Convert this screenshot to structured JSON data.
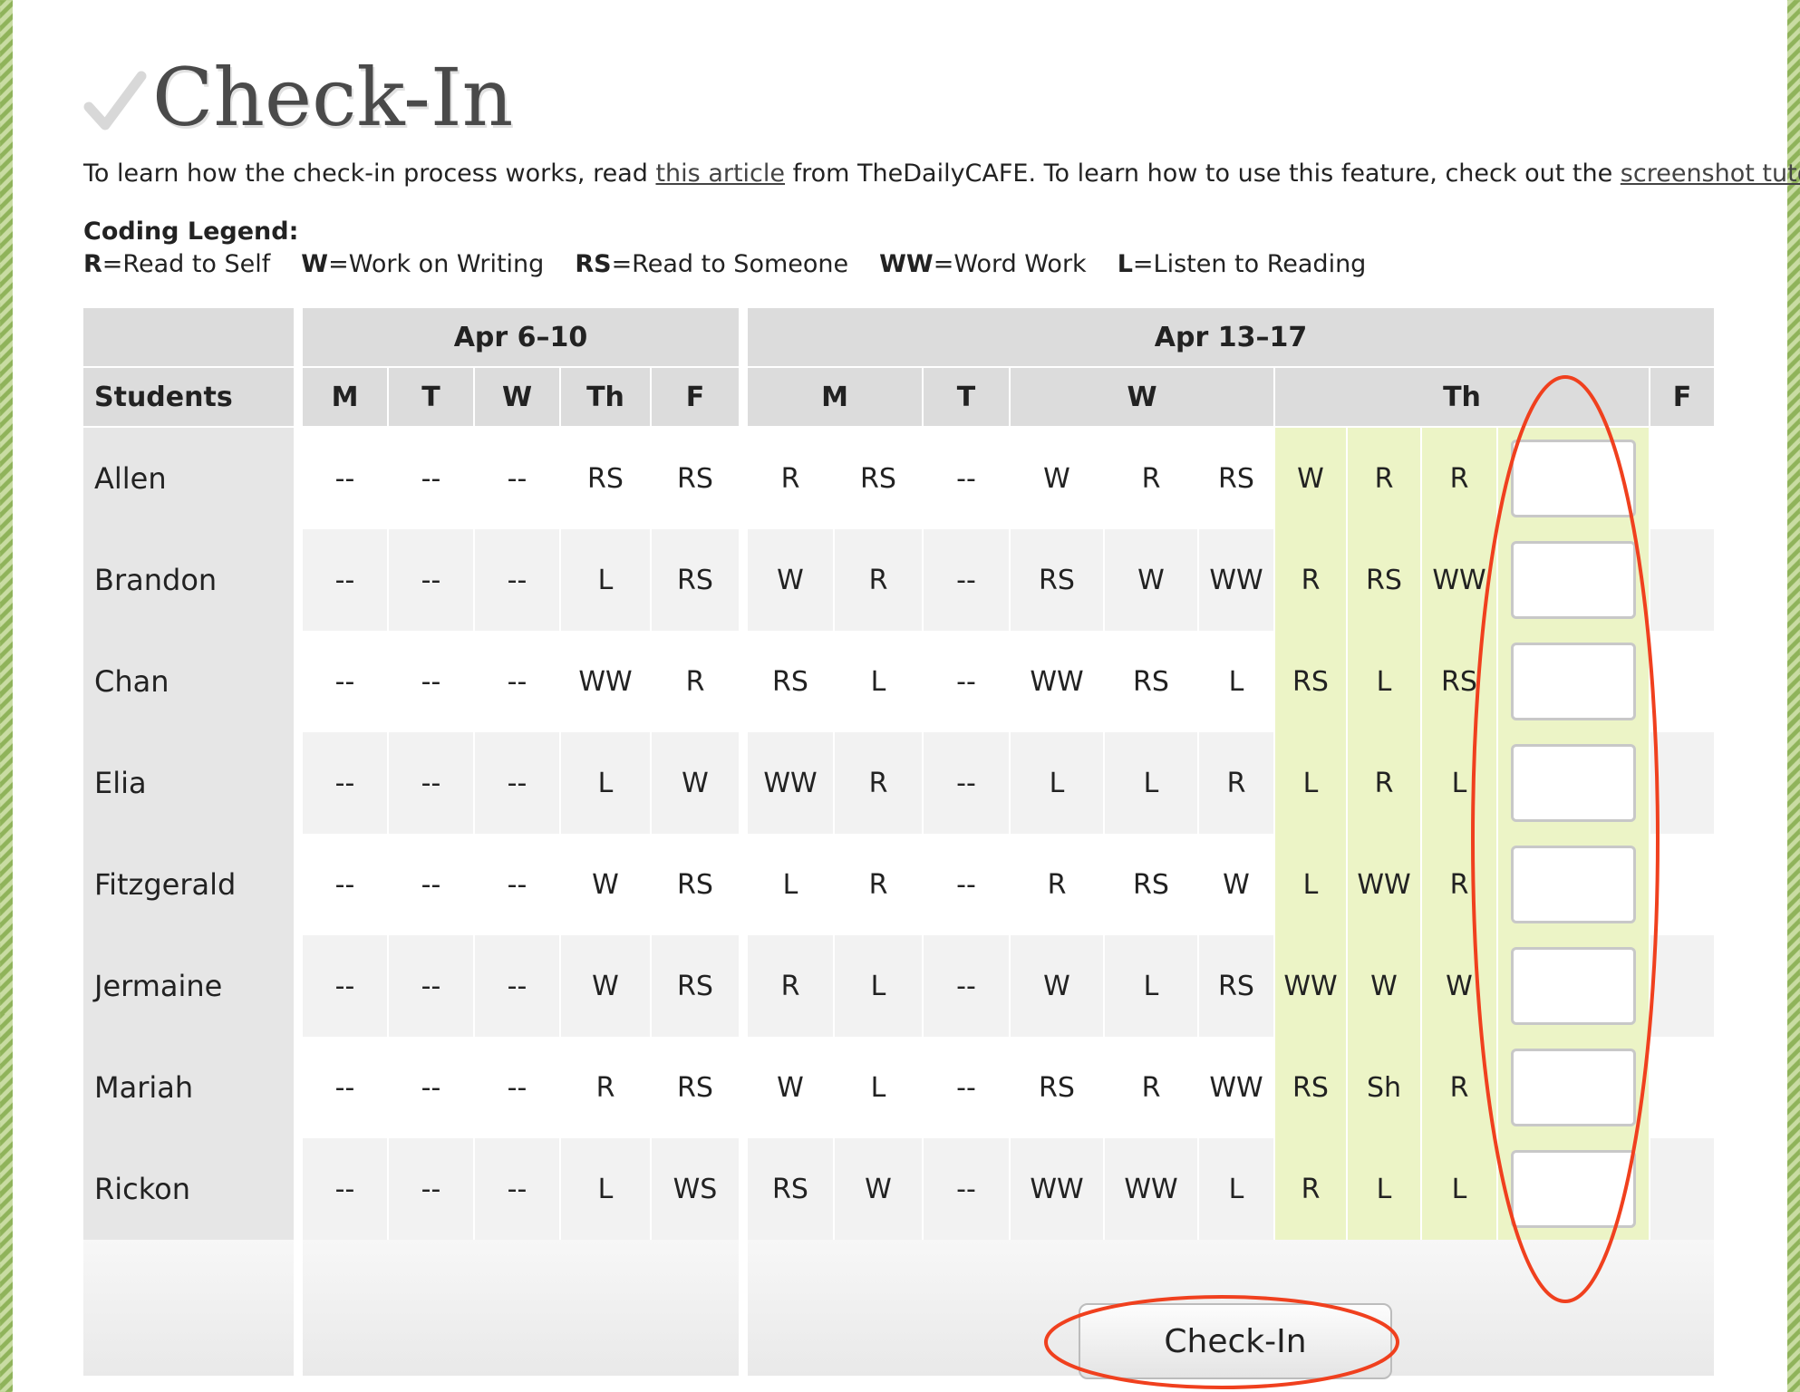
{
  "page": {
    "title": "Check-In",
    "intro": {
      "before": "To learn how the check-in process works, read ",
      "link1": "this article",
      "middle": " from TheDailyCAFE. To learn how to use this feature, check out the ",
      "link2": "screenshot tutorial",
      "after": "."
    },
    "legend": {
      "title": "Coding Legend:",
      "items": [
        {
          "code": "R",
          "label": "=Read to Self"
        },
        {
          "code": "W",
          "label": "=Work on Writing"
        },
        {
          "code": "RS",
          "label": "=Read to Someone"
        },
        {
          "code": "WW",
          "label": "=Word Work"
        },
        {
          "code": "L",
          "label": "=Listen to Reading"
        }
      ]
    }
  },
  "table": {
    "weeks": [
      "Apr 6–10",
      "Apr 13–17"
    ],
    "students_header": "Students",
    "days_week1": [
      "M",
      "T",
      "W",
      "Th",
      "F"
    ],
    "days_week2": [
      "M",
      "T",
      "W",
      "Th",
      "F"
    ],
    "rows": [
      {
        "name": "Allen",
        "codes": [
          "--",
          "--",
          "--",
          "RS",
          "RS",
          "R",
          "RS",
          "--",
          "W",
          "R",
          "RS",
          "W",
          "R",
          "R"
        ]
      },
      {
        "name": "Brandon",
        "codes": [
          "--",
          "--",
          "--",
          "L",
          "RS",
          "W",
          "R",
          "--",
          "RS",
          "W",
          "WW",
          "R",
          "RS",
          "WW"
        ]
      },
      {
        "name": "Chan",
        "codes": [
          "--",
          "--",
          "--",
          "WW",
          "R",
          "RS",
          "L",
          "--",
          "WW",
          "RS",
          "L",
          "RS",
          "L",
          "RS"
        ]
      },
      {
        "name": "Elia",
        "codes": [
          "--",
          "--",
          "--",
          "L",
          "W",
          "WW",
          "R",
          "--",
          "L",
          "L",
          "R",
          "L",
          "R",
          "L"
        ]
      },
      {
        "name": "Fitzgerald",
        "codes": [
          "--",
          "--",
          "--",
          "W",
          "RS",
          "L",
          "R",
          "--",
          "R",
          "RS",
          "W",
          "L",
          "WW",
          "R"
        ]
      },
      {
        "name": "Jermaine",
        "codes": [
          "--",
          "--",
          "--",
          "W",
          "RS",
          "R",
          "L",
          "--",
          "W",
          "L",
          "RS",
          "WW",
          "W",
          "W"
        ]
      },
      {
        "name": "Mariah",
        "codes": [
          "--",
          "--",
          "--",
          "R",
          "RS",
          "W",
          "L",
          "--",
          "RS",
          "R",
          "WW",
          "RS",
          "Sh",
          "R"
        ]
      },
      {
        "name": "Rickon",
        "codes": [
          "--",
          "--",
          "--",
          "L",
          "WS",
          "RS",
          "W",
          "--",
          "WW",
          "WW",
          "L",
          "R",
          "L",
          "L"
        ]
      }
    ]
  },
  "button": {
    "label": "Check-In"
  },
  "colors": {
    "highlight": "#ecf4c6",
    "annotation": "#f0401e",
    "header_bg": "#dcdcdc"
  }
}
